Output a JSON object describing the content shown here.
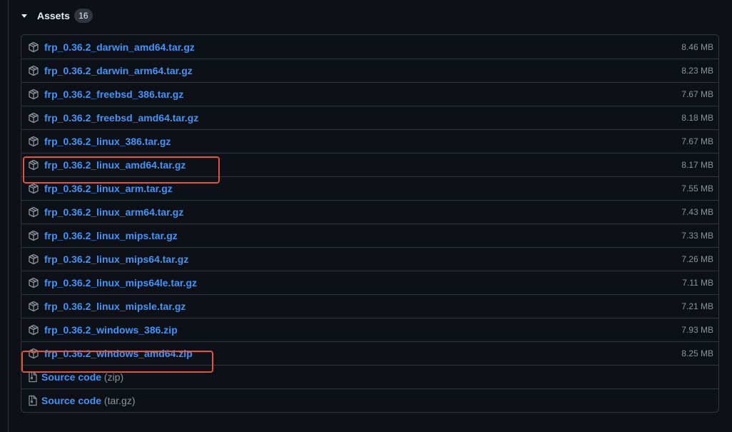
{
  "header": {
    "title": "Assets",
    "count": "16"
  },
  "assets": [
    {
      "name": "frp_0.36.2_darwin_amd64.tar.gz",
      "size": "8.46 MB"
    },
    {
      "name": "frp_0.36.2_darwin_arm64.tar.gz",
      "size": "8.23 MB"
    },
    {
      "name": "frp_0.36.2_freebsd_386.tar.gz",
      "size": "7.67 MB"
    },
    {
      "name": "frp_0.36.2_freebsd_amd64.tar.gz",
      "size": "8.18 MB"
    },
    {
      "name": "frp_0.36.2_linux_386.tar.gz",
      "size": "7.67 MB"
    },
    {
      "name": "frp_0.36.2_linux_amd64.tar.gz",
      "size": "8.17 MB"
    },
    {
      "name": "frp_0.36.2_linux_arm.tar.gz",
      "size": "7.55 MB"
    },
    {
      "name": "frp_0.36.2_linux_arm64.tar.gz",
      "size": "7.43 MB"
    },
    {
      "name": "frp_0.36.2_linux_mips.tar.gz",
      "size": "7.33 MB"
    },
    {
      "name": "frp_0.36.2_linux_mips64.tar.gz",
      "size": "7.26 MB"
    },
    {
      "name": "frp_0.36.2_linux_mips64le.tar.gz",
      "size": "7.11 MB"
    },
    {
      "name": "frp_0.36.2_linux_mipsle.tar.gz",
      "size": "7.21 MB"
    },
    {
      "name": "frp_0.36.2_windows_386.zip",
      "size": "7.93 MB"
    },
    {
      "name": "frp_0.36.2_windows_amd64.zip",
      "size": "8.25 MB"
    }
  ],
  "source_code": [
    {
      "label": "Source code",
      "ext": "(zip)"
    },
    {
      "label": "Source code",
      "ext": "(tar.gz)"
    }
  ],
  "icons": {
    "package": "package-icon",
    "file_zip": "file-zip-icon",
    "caret": "triangle-down-icon"
  },
  "colors": {
    "background": "#0d1117",
    "link": "#4493f8",
    "muted": "#8b949e",
    "border": "#30363d",
    "highlight": "#e5533d"
  }
}
